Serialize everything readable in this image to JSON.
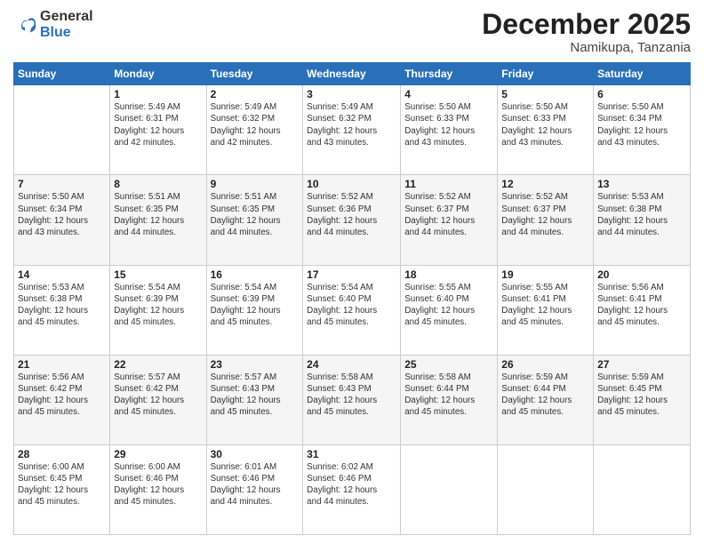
{
  "logo": {
    "general": "General",
    "blue": "Blue"
  },
  "header": {
    "month": "December 2025",
    "location": "Namikupa, Tanzania"
  },
  "weekdays": [
    "Sunday",
    "Monday",
    "Tuesday",
    "Wednesday",
    "Thursday",
    "Friday",
    "Saturday"
  ],
  "weeks": [
    [
      {
        "day": "",
        "sunrise": "",
        "sunset": "",
        "daylight": ""
      },
      {
        "day": "1",
        "sunrise": "Sunrise: 5:49 AM",
        "sunset": "Sunset: 6:31 PM",
        "daylight": "Daylight: 12 hours and 42 minutes."
      },
      {
        "day": "2",
        "sunrise": "Sunrise: 5:49 AM",
        "sunset": "Sunset: 6:32 PM",
        "daylight": "Daylight: 12 hours and 42 minutes."
      },
      {
        "day": "3",
        "sunrise": "Sunrise: 5:49 AM",
        "sunset": "Sunset: 6:32 PM",
        "daylight": "Daylight: 12 hours and 43 minutes."
      },
      {
        "day": "4",
        "sunrise": "Sunrise: 5:50 AM",
        "sunset": "Sunset: 6:33 PM",
        "daylight": "Daylight: 12 hours and 43 minutes."
      },
      {
        "day": "5",
        "sunrise": "Sunrise: 5:50 AM",
        "sunset": "Sunset: 6:33 PM",
        "daylight": "Daylight: 12 hours and 43 minutes."
      },
      {
        "day": "6",
        "sunrise": "Sunrise: 5:50 AM",
        "sunset": "Sunset: 6:34 PM",
        "daylight": "Daylight: 12 hours and 43 minutes."
      }
    ],
    [
      {
        "day": "7",
        "sunrise": "Sunrise: 5:50 AM",
        "sunset": "Sunset: 6:34 PM",
        "daylight": "Daylight: 12 hours and 43 minutes."
      },
      {
        "day": "8",
        "sunrise": "Sunrise: 5:51 AM",
        "sunset": "Sunset: 6:35 PM",
        "daylight": "Daylight: 12 hours and 44 minutes."
      },
      {
        "day": "9",
        "sunrise": "Sunrise: 5:51 AM",
        "sunset": "Sunset: 6:35 PM",
        "daylight": "Daylight: 12 hours and 44 minutes."
      },
      {
        "day": "10",
        "sunrise": "Sunrise: 5:52 AM",
        "sunset": "Sunset: 6:36 PM",
        "daylight": "Daylight: 12 hours and 44 minutes."
      },
      {
        "day": "11",
        "sunrise": "Sunrise: 5:52 AM",
        "sunset": "Sunset: 6:37 PM",
        "daylight": "Daylight: 12 hours and 44 minutes."
      },
      {
        "day": "12",
        "sunrise": "Sunrise: 5:52 AM",
        "sunset": "Sunset: 6:37 PM",
        "daylight": "Daylight: 12 hours and 44 minutes."
      },
      {
        "day": "13",
        "sunrise": "Sunrise: 5:53 AM",
        "sunset": "Sunset: 6:38 PM",
        "daylight": "Daylight: 12 hours and 44 minutes."
      }
    ],
    [
      {
        "day": "14",
        "sunrise": "Sunrise: 5:53 AM",
        "sunset": "Sunset: 6:38 PM",
        "daylight": "Daylight: 12 hours and 45 minutes."
      },
      {
        "day": "15",
        "sunrise": "Sunrise: 5:54 AM",
        "sunset": "Sunset: 6:39 PM",
        "daylight": "Daylight: 12 hours and 45 minutes."
      },
      {
        "day": "16",
        "sunrise": "Sunrise: 5:54 AM",
        "sunset": "Sunset: 6:39 PM",
        "daylight": "Daylight: 12 hours and 45 minutes."
      },
      {
        "day": "17",
        "sunrise": "Sunrise: 5:54 AM",
        "sunset": "Sunset: 6:40 PM",
        "daylight": "Daylight: 12 hours and 45 minutes."
      },
      {
        "day": "18",
        "sunrise": "Sunrise: 5:55 AM",
        "sunset": "Sunset: 6:40 PM",
        "daylight": "Daylight: 12 hours and 45 minutes."
      },
      {
        "day": "19",
        "sunrise": "Sunrise: 5:55 AM",
        "sunset": "Sunset: 6:41 PM",
        "daylight": "Daylight: 12 hours and 45 minutes."
      },
      {
        "day": "20",
        "sunrise": "Sunrise: 5:56 AM",
        "sunset": "Sunset: 6:41 PM",
        "daylight": "Daylight: 12 hours and 45 minutes."
      }
    ],
    [
      {
        "day": "21",
        "sunrise": "Sunrise: 5:56 AM",
        "sunset": "Sunset: 6:42 PM",
        "daylight": "Daylight: 12 hours and 45 minutes."
      },
      {
        "day": "22",
        "sunrise": "Sunrise: 5:57 AM",
        "sunset": "Sunset: 6:42 PM",
        "daylight": "Daylight: 12 hours and 45 minutes."
      },
      {
        "day": "23",
        "sunrise": "Sunrise: 5:57 AM",
        "sunset": "Sunset: 6:43 PM",
        "daylight": "Daylight: 12 hours and 45 minutes."
      },
      {
        "day": "24",
        "sunrise": "Sunrise: 5:58 AM",
        "sunset": "Sunset: 6:43 PM",
        "daylight": "Daylight: 12 hours and 45 minutes."
      },
      {
        "day": "25",
        "sunrise": "Sunrise: 5:58 AM",
        "sunset": "Sunset: 6:44 PM",
        "daylight": "Daylight: 12 hours and 45 minutes."
      },
      {
        "day": "26",
        "sunrise": "Sunrise: 5:59 AM",
        "sunset": "Sunset: 6:44 PM",
        "daylight": "Daylight: 12 hours and 45 minutes."
      },
      {
        "day": "27",
        "sunrise": "Sunrise: 5:59 AM",
        "sunset": "Sunset: 6:45 PM",
        "daylight": "Daylight: 12 hours and 45 minutes."
      }
    ],
    [
      {
        "day": "28",
        "sunrise": "Sunrise: 6:00 AM",
        "sunset": "Sunset: 6:45 PM",
        "daylight": "Daylight: 12 hours and 45 minutes."
      },
      {
        "day": "29",
        "sunrise": "Sunrise: 6:00 AM",
        "sunset": "Sunset: 6:46 PM",
        "daylight": "Daylight: 12 hours and 45 minutes."
      },
      {
        "day": "30",
        "sunrise": "Sunrise: 6:01 AM",
        "sunset": "Sunset: 6:46 PM",
        "daylight": "Daylight: 12 hours and 44 minutes."
      },
      {
        "day": "31",
        "sunrise": "Sunrise: 6:02 AM",
        "sunset": "Sunset: 6:46 PM",
        "daylight": "Daylight: 12 hours and 44 minutes."
      },
      {
        "day": "",
        "sunrise": "",
        "sunset": "",
        "daylight": ""
      },
      {
        "day": "",
        "sunrise": "",
        "sunset": "",
        "daylight": ""
      },
      {
        "day": "",
        "sunrise": "",
        "sunset": "",
        "daylight": ""
      }
    ]
  ]
}
